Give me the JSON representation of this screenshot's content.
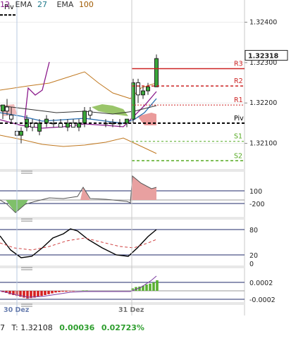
{
  "header": {
    "ema1_value": "12",
    "ema2_label": "EMA",
    "ema2_value": "27",
    "ema3_label": "EMA",
    "ema3_value": "100",
    "colors": {
      "ema1": "#8b1a8b",
      "ema2": "#1f7a8c",
      "ema3": "#a05a00"
    }
  },
  "status": {
    "prefix": "7",
    "tick_label": "T: 1.32108",
    "change_abs": "0.00036",
    "change_pct": "0.02723%",
    "change_color": "#2e9e2e"
  },
  "chart_data": [
    {
      "type": "candlestick",
      "panel": "price",
      "ylim": [
        1.3204,
        1.32455
      ],
      "y_ticks": [
        "1.32400",
        "1.32300",
        "1.32200",
        "1.32100"
      ],
      "current_price_label": "1.32318",
      "x_dates": [
        "30 Dez",
        "31 Dez"
      ],
      "pivot_levels": [
        {
          "name": "R3",
          "value": 1.32285,
          "color": "#cc2222"
        },
        {
          "name": "R2",
          "value": 1.32242,
          "color": "#cc2222"
        },
        {
          "name": "R1",
          "value": 1.32195,
          "color": "#cc2222"
        },
        {
          "name": "Piv",
          "value": 1.3215,
          "color": "#000000"
        },
        {
          "name": "S1",
          "value": 1.32105,
          "color": "#55aa22"
        },
        {
          "name": "S2",
          "value": 1.32057,
          "color": "#55aa22"
        }
      ],
      "left_pivot_label": "Piv",
      "left_pivot_value": 1.32418
    },
    {
      "type": "area",
      "panel": "cci",
      "y_ticks": [
        "100",
        "-200"
      ]
    },
    {
      "type": "line",
      "panel": "stochastic",
      "y_ticks": [
        "80",
        "20",
        "0"
      ]
    },
    {
      "type": "bar",
      "panel": "macd",
      "y_ticks": [
        "0.0002",
        "-0.0002"
      ]
    }
  ]
}
